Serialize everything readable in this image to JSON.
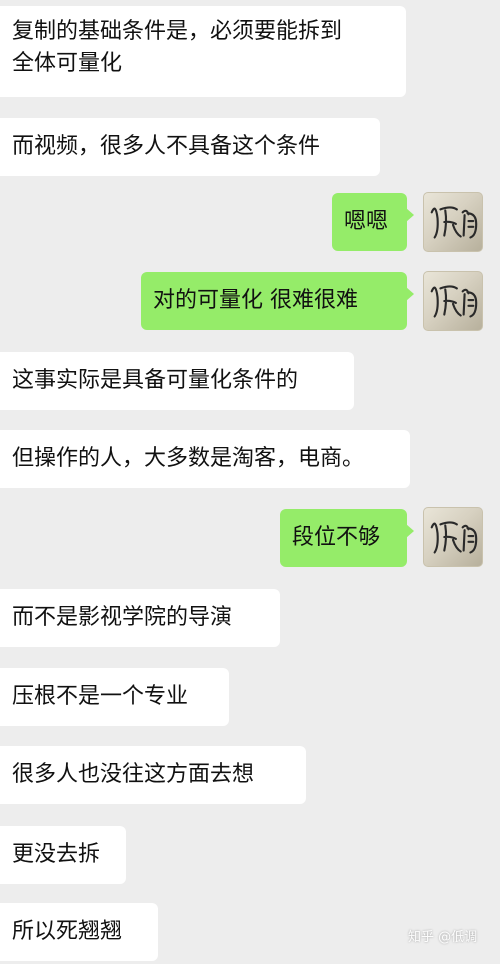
{
  "messages": [
    {
      "side": "left",
      "text": "复制的基础条件是，必须要能拆到\n全体可量化"
    },
    {
      "side": "left",
      "text": "而视频，很多人不具备这个条件"
    },
    {
      "side": "right",
      "text": "嗯嗯"
    },
    {
      "side": "right",
      "text": "对的可量化 很难很难"
    },
    {
      "side": "left",
      "text": "这事实际是具备可量化条件的"
    },
    {
      "side": "left",
      "text": "但操作的人，大多数是淘客，电商。"
    },
    {
      "side": "right",
      "text": "段位不够"
    },
    {
      "side": "left",
      "text": "而不是影视学院的导演"
    },
    {
      "side": "left",
      "text": "压根不是一个专业"
    },
    {
      "side": "left",
      "text": "很多人也没往这方面去想"
    },
    {
      "side": "left",
      "text": "更没去拆"
    },
    {
      "side": "left",
      "text": "所以死翘翘"
    }
  ],
  "avatar": {
    "icon": "handwritten-signature-avatar",
    "text": "低调"
  },
  "watermark": {
    "text": "知乎 @低调"
  }
}
